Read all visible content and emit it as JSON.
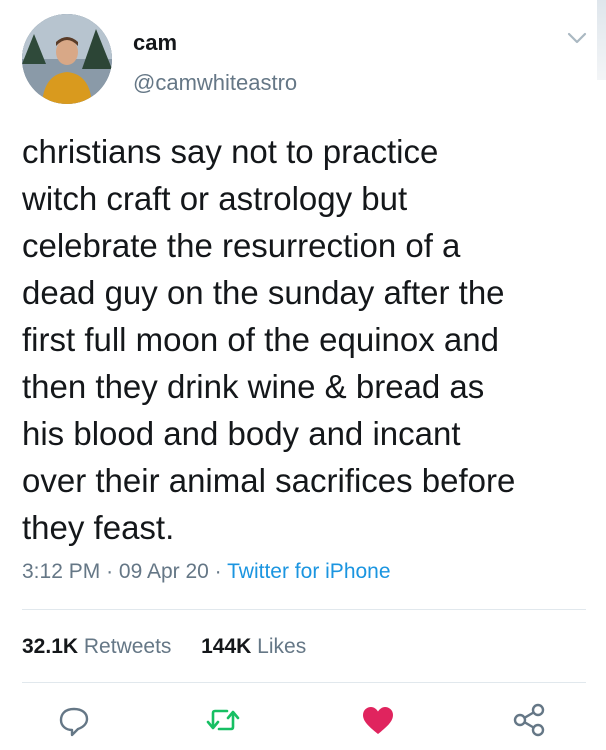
{
  "user": {
    "name": "cam",
    "handle": "@camwhiteastro"
  },
  "tweet": {
    "text": "christians say not to practice\nwitch craft or astrology but\ncelebrate the resurrection of a\ndead guy on the sunday after the\nfirst full moon of the equinox and\nthen they drink wine & bread as\nhis blood and body and incant\nover their animal sacrifices before\nthey feast.",
    "time": "3:12 PM",
    "date": "09 Apr 20",
    "separator": "·",
    "source": "Twitter for iPhone"
  },
  "stats": {
    "retweets_count": "32.1K",
    "retweets_label": "Retweets",
    "likes_count": "144K",
    "likes_label": "Likes"
  },
  "icons": {
    "menu": "chevron-down-icon",
    "reply": "reply-icon",
    "retweet": "retweet-icon",
    "like": "heart-icon",
    "share": "share-icon"
  },
  "colors": {
    "link": "#1b95e0",
    "muted": "#657786",
    "retweet": "#17bf63",
    "like": "#e0245e"
  }
}
